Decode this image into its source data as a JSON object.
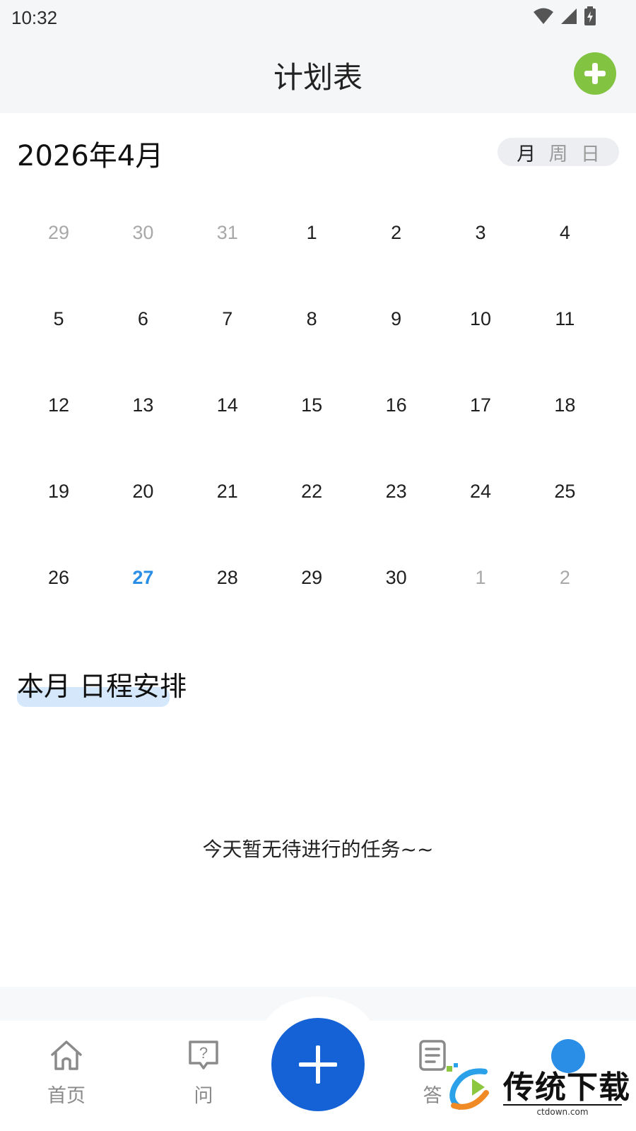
{
  "status_bar": {
    "time": "10:32"
  },
  "header": {
    "title": "计划表",
    "add_icon": "plus-circle-icon",
    "add_color": "#82c341"
  },
  "calendar": {
    "month_label": "2026年4月",
    "view_options": [
      "月",
      "周",
      "日"
    ],
    "active_view": "月",
    "weeks": [
      [
        {
          "d": "29",
          "m": true
        },
        {
          "d": "30",
          "m": true
        },
        {
          "d": "31",
          "m": true
        },
        {
          "d": "1"
        },
        {
          "d": "2"
        },
        {
          "d": "3"
        },
        {
          "d": "4"
        }
      ],
      [
        {
          "d": "5"
        },
        {
          "d": "6"
        },
        {
          "d": "7"
        },
        {
          "d": "8"
        },
        {
          "d": "9"
        },
        {
          "d": "10"
        },
        {
          "d": "11"
        }
      ],
      [
        {
          "d": "12"
        },
        {
          "d": "13"
        },
        {
          "d": "14"
        },
        {
          "d": "15"
        },
        {
          "d": "16"
        },
        {
          "d": "17"
        },
        {
          "d": "18"
        }
      ],
      [
        {
          "d": "19"
        },
        {
          "d": "20"
        },
        {
          "d": "21"
        },
        {
          "d": "22"
        },
        {
          "d": "23"
        },
        {
          "d": "24"
        },
        {
          "d": "25"
        }
      ],
      [
        {
          "d": "26"
        },
        {
          "d": "27",
          "today": true
        },
        {
          "d": "28"
        },
        {
          "d": "29"
        },
        {
          "d": "30"
        },
        {
          "d": "1",
          "m": true
        },
        {
          "d": "2",
          "m": true
        }
      ]
    ],
    "today_color": "#2a8de6"
  },
  "schedule": {
    "title": "本月 日程安排",
    "empty_text": "今天暂无待进行的任务~~"
  },
  "bottom_nav": {
    "items": [
      {
        "label": "首页",
        "icon": "home-icon"
      },
      {
        "label": "问",
        "icon": "question-bubble-icon"
      },
      {
        "label": "答",
        "icon": "document-icon"
      }
    ],
    "fab_icon": "plus-icon",
    "fab_color": "#1462d6"
  },
  "watermark": {
    "text": "传统下载",
    "url": "ctdown.com"
  }
}
